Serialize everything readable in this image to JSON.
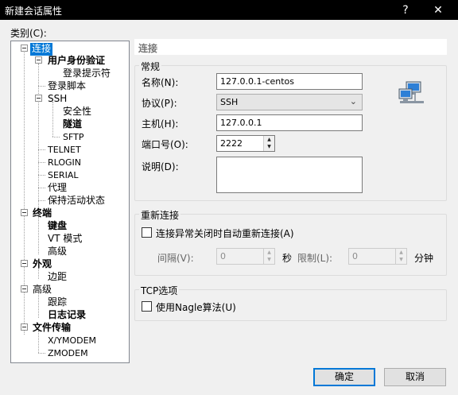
{
  "window": {
    "title": "新建会话属性",
    "help_label": "?",
    "close_label": "✕"
  },
  "category_label": "类别(C):",
  "tree": {
    "items": [
      {
        "label": "连接",
        "selected": true
      },
      {
        "label": "用户身份验证"
      },
      {
        "label": "登录提示符"
      },
      {
        "label": "登录脚本"
      },
      {
        "label": "SSH"
      },
      {
        "label": "安全性"
      },
      {
        "label": "隧道"
      },
      {
        "label": "SFTP"
      },
      {
        "label": "TELNET"
      },
      {
        "label": "RLOGIN"
      },
      {
        "label": "SERIAL"
      },
      {
        "label": "代理"
      },
      {
        "label": "保持活动状态"
      },
      {
        "label": "终端"
      },
      {
        "label": "键盘"
      },
      {
        "label": "VT 模式"
      },
      {
        "label": "高级"
      },
      {
        "label": "外观"
      },
      {
        "label": "边距"
      },
      {
        "label": "高级"
      },
      {
        "label": "跟踪"
      },
      {
        "label": "日志记录"
      },
      {
        "label": "文件传输"
      },
      {
        "label": "X/YMODEM"
      },
      {
        "label": "ZMODEM"
      }
    ]
  },
  "panel": {
    "header": "连接",
    "general": {
      "legend": "常规",
      "name_label": "名称(N):",
      "name_value": "127.0.0.1-centos",
      "protocol_label": "协议(P):",
      "protocol_value": "SSH",
      "host_label": "主机(H):",
      "host_value": "127.0.0.1",
      "port_label": "端口号(O):",
      "port_value": "2222",
      "desc_label": "说明(D):",
      "desc_value": ""
    },
    "reconnect": {
      "legend": "重新连接",
      "checkbox_label": "连接异常关闭时自动重新连接(A)",
      "checked": false,
      "interval_label": "间隔(V):",
      "interval_value": "0",
      "interval_unit": "秒",
      "limit_label": "限制(L):",
      "limit_value": "0",
      "limit_unit": "分钟"
    },
    "tcp": {
      "legend": "TCP选项",
      "checkbox_label": "使用Nagle算法(U)",
      "checked": false
    }
  },
  "buttons": {
    "ok": "确定",
    "cancel": "取消"
  },
  "icons": {
    "network": "network-computers-icon"
  }
}
